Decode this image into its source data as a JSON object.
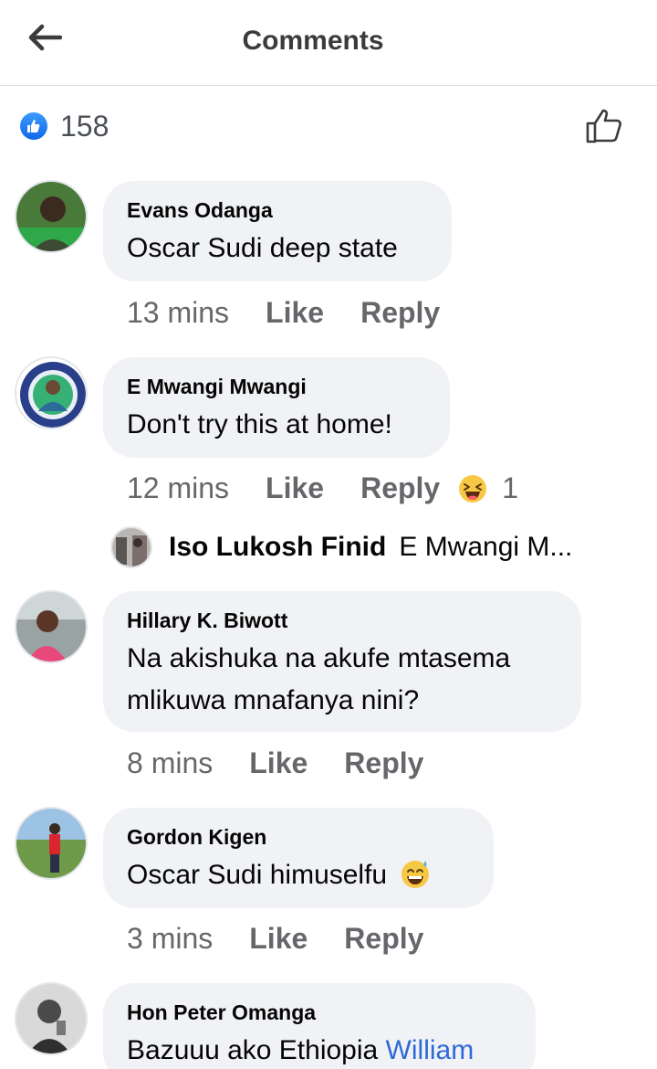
{
  "header": {
    "title": "Comments",
    "back_icon": "arrow-left-icon"
  },
  "reactions": {
    "count": "158",
    "icon": "like-reaction-icon",
    "action_icon": "thumbs-up-outline-icon"
  },
  "comments": [
    {
      "name": "Evans Odanga",
      "text": "Oscar Sudi deep state",
      "time": "13 mins",
      "like": "Like",
      "reply": "Reply"
    },
    {
      "name": "E Mwangi Mwangi",
      "text": "Don't try this at home!",
      "time": "12 mins",
      "like": "Like",
      "reply": "Reply",
      "reaction_icon": "laughing-emoji-icon",
      "reaction_count": "1"
    },
    {
      "name": "Hillary K. Biwott",
      "text_line1": "Na akishuka na akufe mtasema",
      "text_line2": "mlikuwa mnafanya nini?",
      "time": "8 mins",
      "like": "Like",
      "reply": "Reply"
    },
    {
      "name": "Gordon Kigen",
      "text": "Oscar Sudi himuselfu",
      "emoji": "sweat-smile-emoji-icon",
      "time": "3 mins",
      "like": "Like",
      "reply": "Reply"
    },
    {
      "name": "Hon Peter Omanga",
      "text": "Bazuuu ako Ethiopia",
      "mention": "William"
    }
  ],
  "reply_preview": {
    "name": "Iso Lukosh Finid",
    "snippet": "E Mwangi M..."
  },
  "colors": {
    "accent": "#1877f2",
    "bubble": "#f0f2f5",
    "meta": "#65676b",
    "mention": "#2d6ad6"
  }
}
